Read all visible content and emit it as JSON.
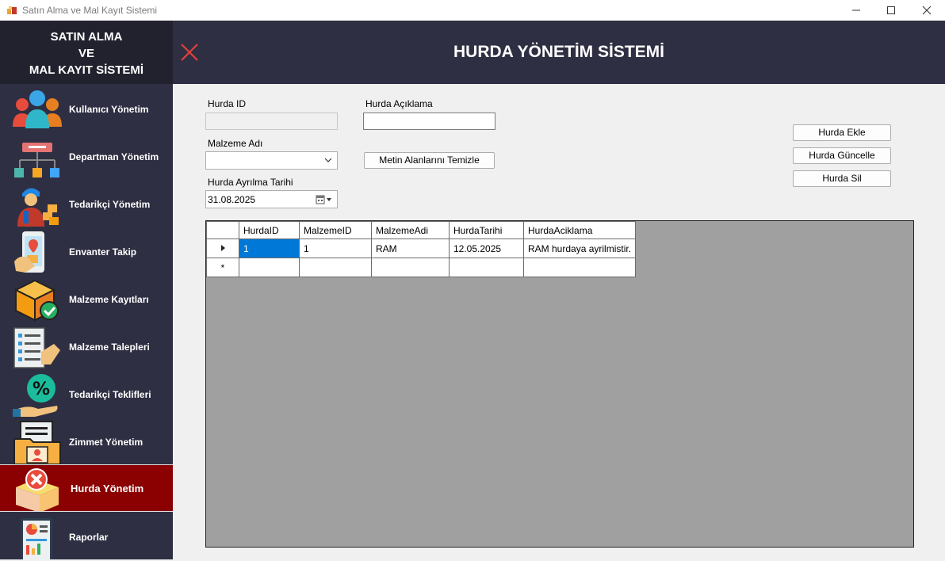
{
  "window": {
    "title": "Satın Alma ve Mal Kayıt Sistemi"
  },
  "sidebar": {
    "brand_line1": "SATIN ALMA",
    "brand_line2": "VE",
    "brand_line3": "MAL KAYIT SİSTEMİ",
    "items": [
      {
        "label": "Kullanıcı Yönetim",
        "icon": "users-icon"
      },
      {
        "label": "Departman Yönetim",
        "icon": "org-chart-icon"
      },
      {
        "label": "Tedarikçi Yönetim",
        "icon": "courier-icon"
      },
      {
        "label": "Envanter Takip",
        "icon": "location-phone-icon"
      },
      {
        "label": "Malzeme Kayıtları",
        "icon": "box-check-icon"
      },
      {
        "label": "Malzeme Talepleri",
        "icon": "checklist-icon"
      },
      {
        "label": "Tedarikçi Teklifleri",
        "icon": "percent-hand-icon"
      },
      {
        "label": "Zimmet Yönetim",
        "icon": "folder-user-icon"
      },
      {
        "label": "Hurda Yönetim",
        "icon": "box-remove-icon",
        "active": true
      },
      {
        "label": "Raporlar",
        "icon": "report-icon"
      }
    ]
  },
  "header": {
    "title": "HURDA YÖNETİM SİSTEMİ"
  },
  "form": {
    "hurda_id_label": "Hurda ID",
    "hurda_id_value": "",
    "aciklama_label": "Hurda Açıklama",
    "aciklama_value": "",
    "malzeme_label": "Malzeme Adı",
    "malzeme_value": "",
    "tarih_label": "Hurda Ayrılma Tarihi",
    "tarih_value": "31.08.2025",
    "clear_button": "Metin Alanlarını Temizle"
  },
  "actions": {
    "add": "Hurda Ekle",
    "update": "Hurda Güncelle",
    "delete": "Hurda Sil"
  },
  "grid": {
    "columns": [
      "HurdaID",
      "MalzemeID",
      "MalzemeAdi",
      "HurdaTarihi",
      "HurdaAciklama"
    ],
    "rows": [
      [
        "1",
        "1",
        "RAM",
        "12.05.2025",
        "RAM hurdaya ayrilmistir."
      ]
    ],
    "new_row_marker": "*"
  },
  "colors": {
    "sidebar_bg": "#2f2f43",
    "brand_bg": "#22222f",
    "active_item": "#8b0000",
    "close_icon": "#e0413a",
    "selected_cell": "#0078d7"
  }
}
